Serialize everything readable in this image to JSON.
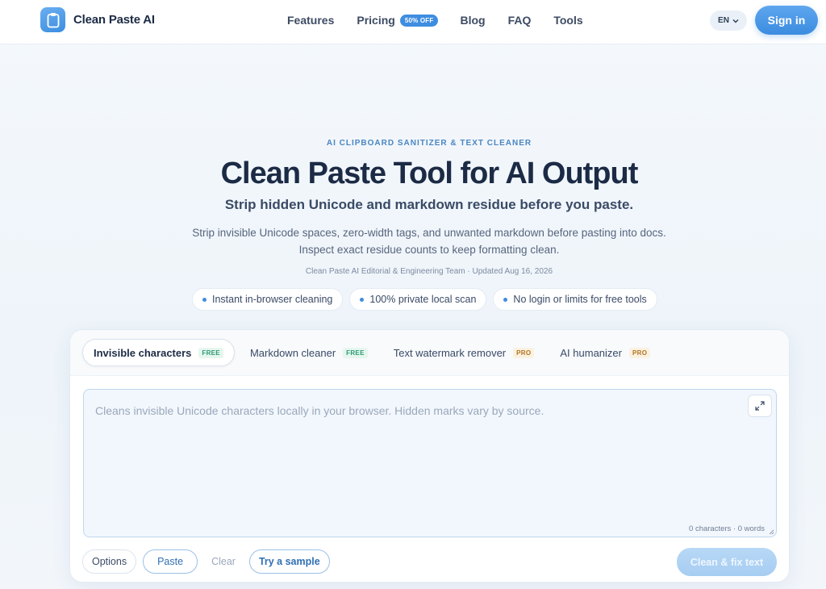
{
  "header": {
    "logo_text": "Clean Paste AI",
    "nav": {
      "features": "Features",
      "pricing": "Pricing",
      "pricing_badge": "50% OFF",
      "blog": "Blog",
      "faq": "FAQ",
      "tools": "Tools"
    },
    "language": "EN",
    "sign_in": "Sign in"
  },
  "hero": {
    "eyebrow": "AI CLIPBOARD SANITIZER & TEXT CLEANER",
    "title": "Clean Paste Tool for AI Output",
    "subtitle": "Strip hidden Unicode and markdown residue before you paste.",
    "description": "Strip invisible Unicode spaces, zero-width tags, and unwanted markdown before pasting into docs. Inspect exact residue counts to keep formatting clean.",
    "byline": "Clean Paste AI Editorial & Engineering Team · Updated Aug 16, 2026",
    "chips": [
      "Instant in-browser cleaning",
      "100% private local scan",
      "No login or limits for free tools"
    ]
  },
  "tool": {
    "tabs": [
      {
        "label": "Invisible characters",
        "tag": "FREE"
      },
      {
        "label": "Markdown cleaner",
        "tag": "FREE"
      },
      {
        "label": "Text watermark remover",
        "tag": "PRO"
      },
      {
        "label": "AI humanizer",
        "tag": "PRO"
      }
    ],
    "editor_placeholder": "Cleans invisible Unicode characters locally in your browser. Hidden marks vary by source.",
    "counter": "0 characters · 0 words",
    "buttons": {
      "options": "Options",
      "paste": "Paste",
      "clear": "Clear",
      "sample": "Try a sample",
      "clean": "Clean & fix text"
    }
  },
  "colors": {
    "accent": "#3f8de0",
    "free_tag": "#2a9a73",
    "pro_tag": "#b0741f"
  }
}
